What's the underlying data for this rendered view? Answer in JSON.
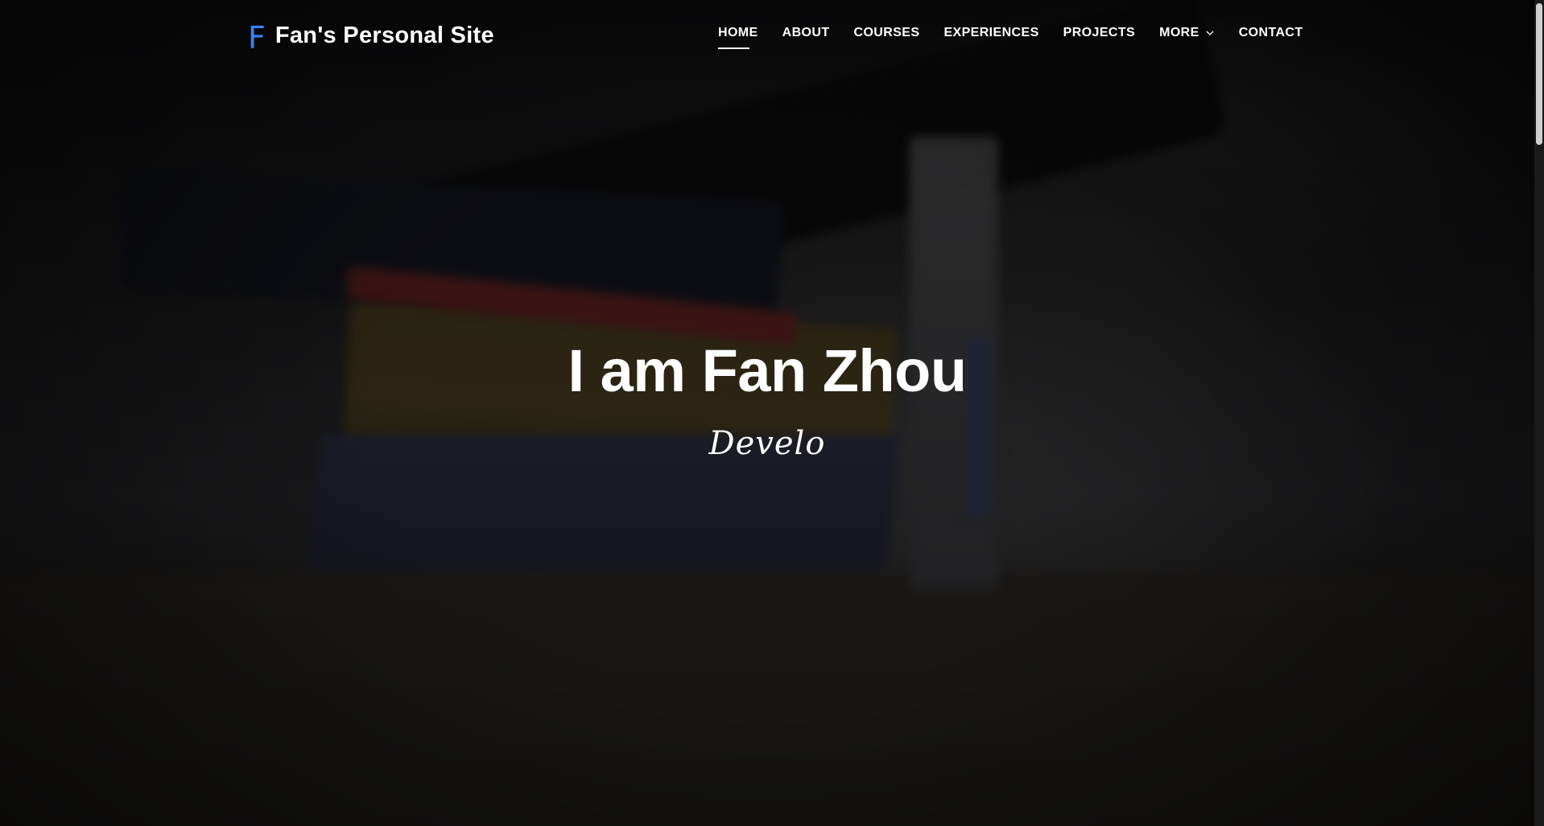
{
  "site": {
    "logo_letter": "F",
    "title": "Fan's Personal Site",
    "accent_color": "#3b82f6"
  },
  "nav": {
    "items": [
      {
        "label": "HOME",
        "active": true
      },
      {
        "label": "ABOUT"
      },
      {
        "label": "COURSES"
      },
      {
        "label": "EXPERIENCES"
      },
      {
        "label": "PROJECTS"
      },
      {
        "label": "MORE",
        "icon": "chevron-down-icon"
      },
      {
        "label": "CONTACT"
      }
    ]
  },
  "hero": {
    "title": "I am Fan Zhou",
    "subtitle": "Develo"
  }
}
